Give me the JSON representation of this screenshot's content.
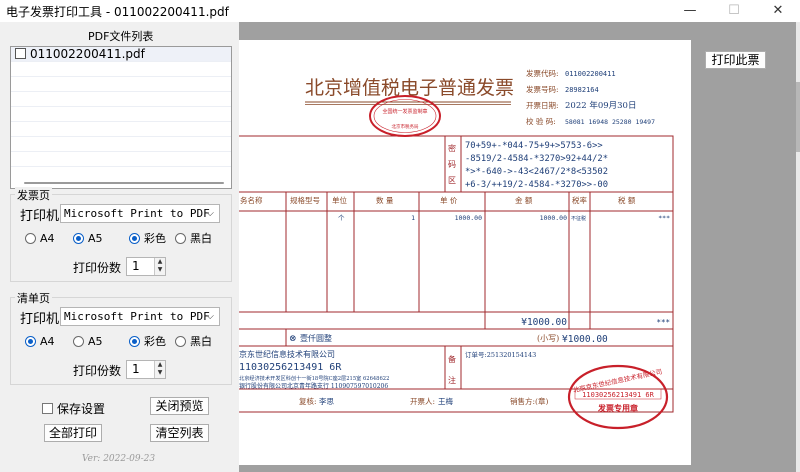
{
  "window": {
    "title": "电子发票打印工具  -  011002200411.pdf",
    "minimize": "—",
    "maximize": "☐",
    "close": "✕"
  },
  "file_list": {
    "label": "PDF文件列表",
    "files": [
      "011002200411.pdf"
    ]
  },
  "invoice_page": {
    "label": "发票页",
    "printer_label": "打印机",
    "printer": "Microsoft Print to PDF",
    "paper_sizes": [
      "A4",
      "A5"
    ],
    "paper_selected": "A5",
    "color_modes": [
      "彩色",
      "黑白"
    ],
    "color_selected": "彩色",
    "copies_label": "打印份数",
    "copies": "1"
  },
  "list_page": {
    "label": "清单页",
    "printer_label": "打印机",
    "printer": "Microsoft Print to PDF",
    "paper_sizes": [
      "A4",
      "A5"
    ],
    "paper_selected": "A4",
    "color_modes": [
      "彩色",
      "黑白"
    ],
    "color_selected": "彩色",
    "copies_label": "打印份数",
    "copies": "1"
  },
  "actions": {
    "save_settings": "保存设置",
    "close_preview": "关闭预览",
    "print_all": "全部打印",
    "clear_list": "清空列表",
    "print_this": "打印此票"
  },
  "version": "Ver: 2022-09-23",
  "invoice": {
    "title": "北京增值税电子普通发票",
    "meta": [
      {
        "label": "发票代码:",
        "value": "011002200411"
      },
      {
        "label": "发票号码:",
        "value": "28982164"
      },
      {
        "label": "开票日期:",
        "value": "2022 年09月30日"
      },
      {
        "label": "校 验 码:",
        "value": "58081 16948 25280 19497"
      }
    ],
    "password_label": [
      "密",
      "码",
      "区"
    ],
    "cipher": [
      "70+59+-*044-75+9+>5753-6>>",
      "-8519/2-4584-*3270>92+44/2*",
      "*>*-640->-43<2467/2*8<53502",
      "+6-3/++19/2-4584-*3270>>-00"
    ],
    "headers": [
      "务名称",
      "规格型号",
      "单位",
      "数  量",
      "单  价",
      "金  额",
      "税率",
      "税  额"
    ],
    "item": {
      "unit": "个",
      "qty": "1",
      "price": "1000.00",
      "amount": "1000.00",
      "rate": "不征税",
      "tax": "***"
    },
    "subtotal_amount": "¥1000.00",
    "subtotal_tax": "***",
    "total_words_icon": "⊗",
    "total_words": "壹仟圆整",
    "total_small_label": "(小写)",
    "total_small": "¥1000.00",
    "seller_lines": [
      "京东世纪信息技术有限公司",
      "11030256213491 6R",
      "北京经济技术开发区科创十一街18号院C座2层215室 62648622",
      "银行股份有限公司北京青年路支行 110907597010206"
    ],
    "remark_label": [
      "备",
      "注"
    ],
    "order_no": "订单号:251320154143",
    "reviewer_label": "复核:",
    "reviewer": "李思",
    "drawer_label": "开票人:",
    "drawer": "王梅",
    "seller_sign_label": "销售方:(章)",
    "seal_top_text": "全国统一发票监制章",
    "seal_top_text2": "北京市税务局",
    "seal_bottom_text": "北京京东世纪信息技术有限公司",
    "seal_bottom_code": "11030256213491 6R",
    "seal_bottom_label": "发票专用章"
  },
  "colors": {
    "invoice_red": "#a0282c",
    "invoice_brown": "#8a4a2a",
    "text_blue": "#1f3f78",
    "accent": "#0a5fc8"
  }
}
